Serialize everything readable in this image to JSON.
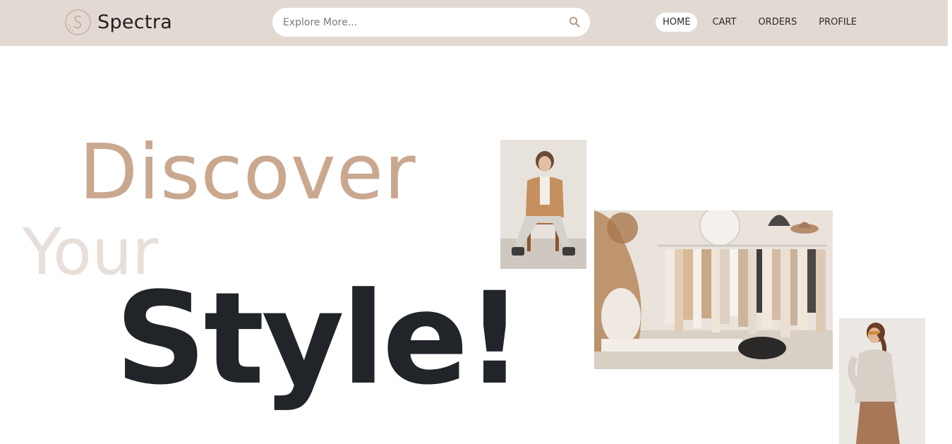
{
  "header": {
    "brand": "Spectra",
    "search": {
      "placeholder": "Explore More...",
      "value": ""
    },
    "nav": [
      {
        "label": "HOME",
        "active": true
      },
      {
        "label": "CART",
        "active": false
      },
      {
        "label": "ORDERS",
        "active": false
      },
      {
        "label": "PROFILE",
        "active": false
      }
    ]
  },
  "hero": {
    "word1": "Discover",
    "word2": "Your",
    "word3": "Style!"
  },
  "colors": {
    "header_bg": "#e2d9d2",
    "accent": "#caa88f",
    "faded": "#e6dfda",
    "dark": "#212428"
  },
  "icons": {
    "logo": "logo-s-circle-icon",
    "search": "search-icon"
  }
}
